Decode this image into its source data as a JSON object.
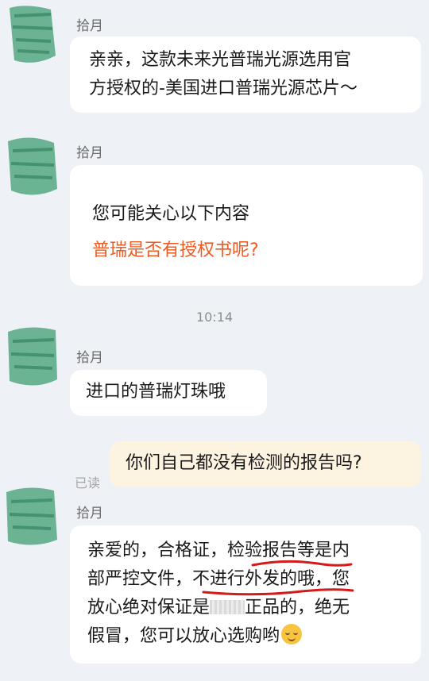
{
  "contact_name": "拾月",
  "timestamp": "10:14",
  "read_receipt": "已读",
  "messages": {
    "m1": {
      "line1": "亲亲，这款未来光普瑞光源选用官",
      "line2": "方授权的-美国进口普瑞光源芯片～"
    },
    "m2": {
      "intro": "您可能关心以下内容",
      "suggestion": "普瑞是否有授权书呢?"
    },
    "m3": {
      "text": "进口的普瑞灯珠哦"
    },
    "m4": {
      "text": "你们自己都没有检测的报告吗?"
    },
    "m5": {
      "line1": "亲爱的，合格证，检验报告等是内",
      "line2": "部严控文件，不进行外发的哦，您",
      "line3a": "放心绝对保证是",
      "line3b": "正品的，绝无",
      "line4": "假冒，您可以放心选购哟"
    }
  },
  "colors": {
    "background": "#eef1f6",
    "bubble_incoming": "#ffffff",
    "bubble_outgoing": "#fdf3e1",
    "suggestion_link": "#ef5a22",
    "annotation_red": "#d21b1b",
    "avatar_green": "#3f9e72"
  },
  "icons": {
    "avatar": "avatar-image",
    "emoji": "relieved-face-emoji-icon"
  }
}
